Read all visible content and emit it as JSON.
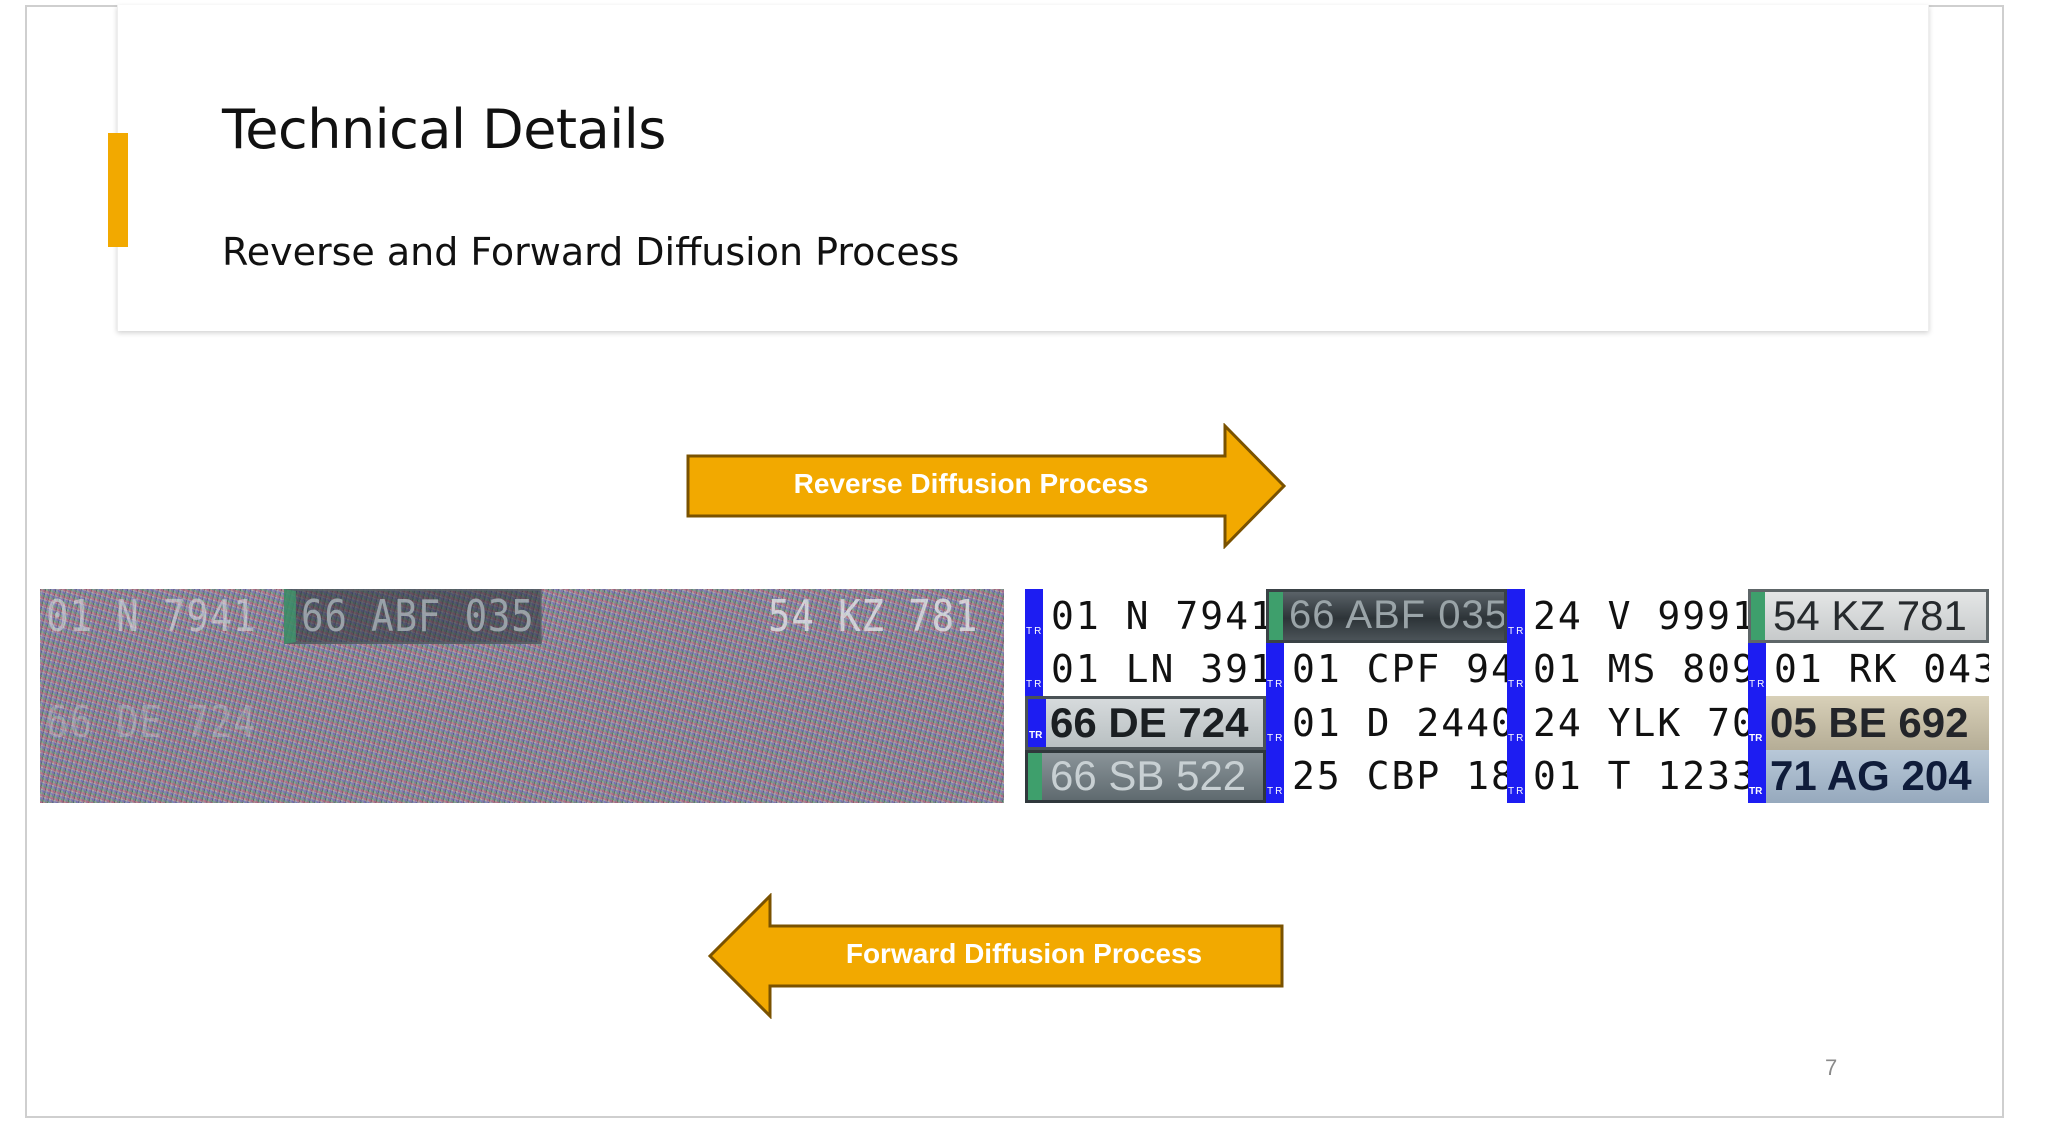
{
  "slide": {
    "title": "Technical Details",
    "subtitle": "Reverse and Forward Diffusion Process",
    "page_number": "7",
    "accent_color": "#f2a900"
  },
  "arrows": {
    "reverse": {
      "label": "Reverse Diffusion Process",
      "direction": "right",
      "color": "#f2a900"
    },
    "forward": {
      "label": "Forward Diffusion Process",
      "direction": "left",
      "color": "#f2a900"
    }
  },
  "noisy_image": {
    "faint_plates": [
      "01 N 7941",
      "66 ABF 035",
      "54 KZ 781",
      "66 DE 724"
    ]
  },
  "plates": [
    {
      "text": "01 N 7941",
      "style": "white"
    },
    {
      "text": "66 ABF 035",
      "style": "photo-dark"
    },
    {
      "text": "24 V 9991",
      "style": "white"
    },
    {
      "text": "54 KZ 781",
      "style": "photo-light-green"
    },
    {
      "text": "01 LN 391",
      "style": "white"
    },
    {
      "text": "01 CPF 94",
      "style": "white"
    },
    {
      "text": "01 MS 809",
      "style": "white"
    },
    {
      "text": "01 RK 043",
      "style": "white"
    },
    {
      "text": "66 DE 724",
      "style": "photo-light"
    },
    {
      "text": "01 D 2440",
      "style": "white"
    },
    {
      "text": "24 YLK 70",
      "style": "white"
    },
    {
      "text": "05 BE 692",
      "style": "photo-beige"
    },
    {
      "text": "66 SB 522",
      "style": "photo-gray"
    },
    {
      "text": "25 CBP 18",
      "style": "white"
    },
    {
      "text": "01 T 1233",
      "style": "white"
    },
    {
      "text": "71 AG 204",
      "style": "photo-blue"
    }
  ]
}
